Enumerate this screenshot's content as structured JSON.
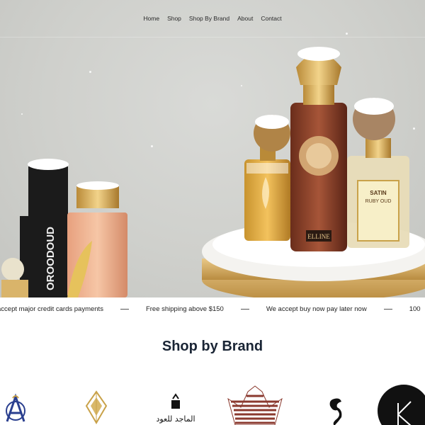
{
  "nav": {
    "items": [
      {
        "label": "Home"
      },
      {
        "label": "Shop"
      },
      {
        "label": "Shop By Brand"
      },
      {
        "label": "About"
      },
      {
        "label": "Contact"
      }
    ]
  },
  "hero": {
    "bottle_labels": {
      "left_tall": "OROODOUD",
      "center_red": "ELLINE",
      "right_box_top": "SATIN",
      "right_box_bottom": "RUBY OUD"
    }
  },
  "marquee": {
    "items": [
      "accept major credit cards payments",
      "Free shipping above $150",
      "We accept buy now pay later now",
      "100"
    ]
  },
  "brands": {
    "title": "Shop by Brand",
    "logos": [
      {
        "name": "brand-a-logo"
      },
      {
        "name": "gold-emblem-logo"
      },
      {
        "name": "almajed-oud-logo",
        "text": "الماجد للعود"
      },
      {
        "name": "striped-crown-logo"
      },
      {
        "name": "panther-logo"
      },
      {
        "name": "k-circle-logo"
      }
    ]
  },
  "colors": {
    "title": "#1a2535",
    "hero_bg": "#cfd0cc",
    "gold": "#c9a24a"
  }
}
